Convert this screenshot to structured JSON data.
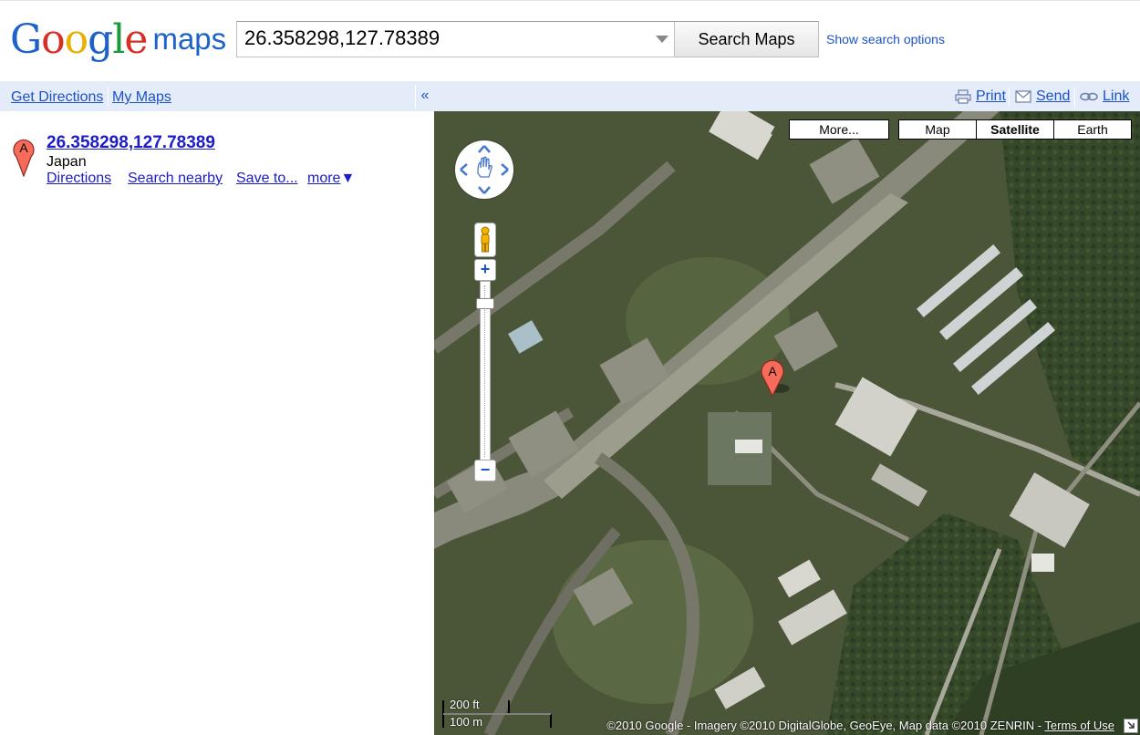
{
  "header": {
    "logo_google": "Google",
    "logo_maps": "maps",
    "search_value": "26.358298,127.78389",
    "search_button": "Search Maps",
    "show_options": "Show search options"
  },
  "left_toolbar": {
    "get_directions": "Get Directions",
    "my_maps": "My Maps",
    "collapse": "«"
  },
  "right_toolbar": {
    "print": "Print",
    "send": "Send",
    "link": "Link"
  },
  "result": {
    "marker_letter": "A",
    "title": "26.358298,127.78389",
    "country": "Japan",
    "links": [
      "Directions",
      "Search nearby",
      "Save to...",
      "more"
    ],
    "more_arrow": "▼"
  },
  "map": {
    "more_button": "More...",
    "types": [
      "Map",
      "Satellite",
      "Earth"
    ],
    "selected_type": "Satellite",
    "zoom_in": "+",
    "zoom_out": "−",
    "scale_ft": "200 ft",
    "scale_m": "100 m",
    "copyright": "©2010 Google - Imagery ©2010 DigitalGlobe, GeoEye, Map data ©2010 ZENRIN - ",
    "terms": "Terms of Use",
    "marker_letter": "A"
  },
  "colors": {
    "link_blue": "#1c52c8",
    "toolbar_bg": "#e5ecf9",
    "marker_red": "#f76b5a"
  }
}
